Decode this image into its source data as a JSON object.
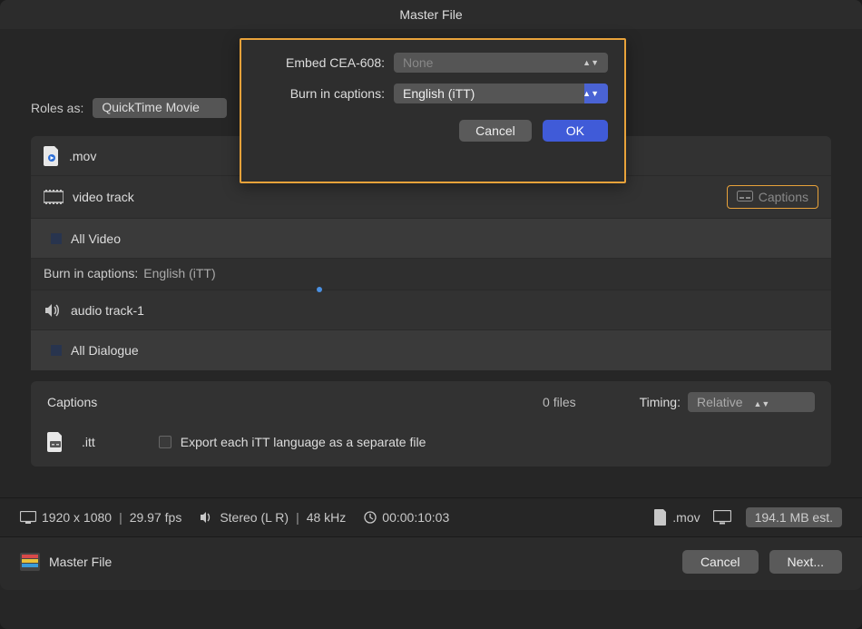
{
  "title": "Master File",
  "roles": {
    "label": "Roles as:",
    "value": "QuickTime Movie"
  },
  "popover": {
    "embed_label": "Embed CEA-608:",
    "embed_value": "None",
    "burn_label": "Burn in captions:",
    "burn_value": "English (iTT)",
    "cancel": "Cancel",
    "ok": "OK"
  },
  "tracks": {
    "file_ext": ".mov",
    "video_track": "video track",
    "captions_btn": "Captions",
    "all_video": "All Video",
    "burn_label": "Burn in captions:",
    "burn_value": "English (iTT)",
    "audio_track": "audio track-1",
    "all_dialogue": "All Dialogue"
  },
  "captions": {
    "heading": "Captions",
    "files": "0 files",
    "timing_label": "Timing:",
    "timing_value": "Relative",
    "file_ext": ".itt",
    "export_each": "Export each iTT language as a separate file"
  },
  "status": {
    "resolution": "1920 x 1080",
    "fps": "29.97 fps",
    "audio": "Stereo (L R)",
    "khz": "48 kHz",
    "duration": "00:00:10:03",
    "out_ext": ".mov",
    "size": "194.1 MB est."
  },
  "footer": {
    "title": "Master File",
    "cancel": "Cancel",
    "next": "Next..."
  }
}
